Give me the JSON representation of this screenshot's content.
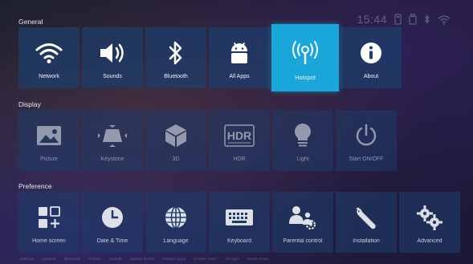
{
  "status": {
    "time": "15:44"
  },
  "sections": {
    "general": "General",
    "display": "Display",
    "preference": "Preference"
  },
  "general_items": [
    {
      "label": "Network",
      "icon": "wifi-icon"
    },
    {
      "label": "Sounds",
      "icon": "speaker-icon"
    },
    {
      "label": "Bluetooth",
      "icon": "bluetooth-icon"
    },
    {
      "label": "All Apps",
      "icon": "android-icon"
    },
    {
      "label": "Hotspot",
      "icon": "hotspot-icon",
      "focused": true
    },
    {
      "label": "About",
      "icon": "info-icon"
    }
  ],
  "display_items": [
    {
      "label": "Picture",
      "icon": "image-icon"
    },
    {
      "label": "Keystone",
      "icon": "keystone-icon"
    },
    {
      "label": "3D",
      "icon": "cube-icon"
    },
    {
      "label": "HDR",
      "icon": "hdr-icon"
    },
    {
      "label": "Light",
      "icon": "lightbulb-icon"
    },
    {
      "label": "Start ON/OFF",
      "icon": "power-icon"
    }
  ],
  "preference_items": [
    {
      "label": "Home screen",
      "icon": "home-grid-icon"
    },
    {
      "label": "Date & Time",
      "icon": "clock-icon"
    },
    {
      "label": "Language",
      "icon": "globe-icon"
    },
    {
      "label": "Keyboard",
      "icon": "keyboard-icon"
    },
    {
      "label": "Parental control",
      "icon": "parental-icon"
    },
    {
      "label": "Installation",
      "icon": "wrench-icon"
    },
    {
      "label": "Advanced",
      "icon": "gears-icon"
    }
  ],
  "dock_items": [
    "Settings",
    "Network",
    "Bluetooth",
    "Picture",
    "Sounds",
    "System Books",
    "Remote Apps",
    "Screen Setter",
    "All Apps",
    "World Smart"
  ],
  "colors": {
    "tile": "#1e3c69",
    "focus": "#1aa6d9",
    "text": "#ffffff"
  }
}
